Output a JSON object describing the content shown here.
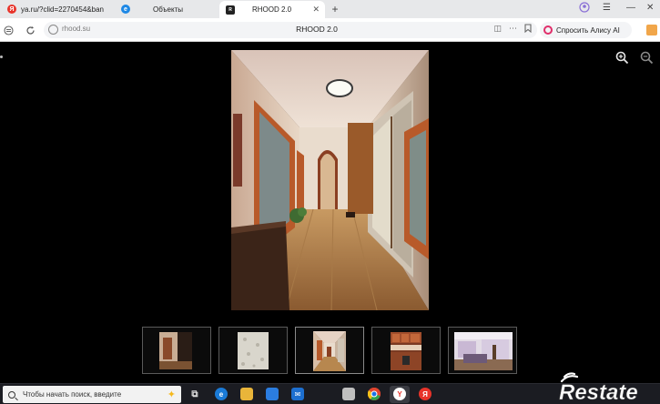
{
  "browser": {
    "tabs": [
      {
        "label": "ya.ru/?clid=2270454&ban",
        "favicon": "yandex-y-icon",
        "color": "#e8332a"
      },
      {
        "label": "Объекты",
        "favicon": "edge-style-icon",
        "color": "#1e88e5"
      },
      {
        "label": "RHOOD 2.0",
        "favicon": "rhood-icon",
        "color": "#222222",
        "active": true
      }
    ],
    "new_tab_label": "+",
    "address": {
      "url": "rhood.su",
      "page_title": "RHOOD 2.0",
      "alice_label": "Спросить Алису AI"
    },
    "window_controls": [
      "—",
      "✕"
    ]
  },
  "viewer": {
    "zoom_in_icon": "zoom-in-icon",
    "zoom_out_icon": "zoom-out-icon",
    "photo_subject": "hallway-interior",
    "thumbnails": [
      {
        "name": "room-photo",
        "active": false
      },
      {
        "name": "wall-texture-photo",
        "active": false
      },
      {
        "name": "hallway-photo",
        "active": true
      },
      {
        "name": "kitchen-photo",
        "active": false
      },
      {
        "name": "living-room-photo",
        "active": false
      }
    ]
  },
  "taskbar": {
    "search_placeholder": "Чтобы начать поиск, введите",
    "apps": [
      "task-view-icon",
      "edge-icon",
      "file-explorer-icon",
      "store-icon",
      "mail-icon",
      "calendar-icon",
      "chrome-icon",
      "yandex-browser-icon",
      "yandex-icon"
    ]
  },
  "watermark": {
    "text": "Restate"
  },
  "colors": {
    "accent_pink": "#e02e6a",
    "yandex_red": "#e8332a",
    "viewer_bg": "#000000",
    "taskbar_bg": "#1b1c22"
  }
}
